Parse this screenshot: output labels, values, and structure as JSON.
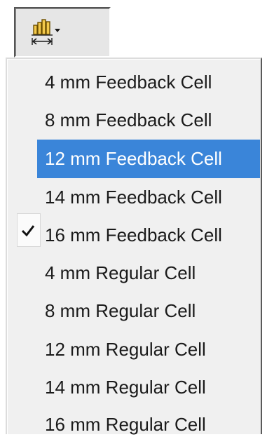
{
  "toolbar": {
    "icon": "bar-chart-width-dropdown-icon"
  },
  "menu": {
    "selected_index": 2,
    "items": [
      {
        "label": "4 mm Feedback Cell"
      },
      {
        "label": "8 mm Feedback Cell"
      },
      {
        "label": "12 mm Feedback Cell"
      },
      {
        "label": "14 mm Feedback Cell"
      },
      {
        "label": "16 mm Feedback Cell"
      },
      {
        "label": "4 mm Regular Cell"
      },
      {
        "label": "8 mm Regular Cell"
      },
      {
        "label": "12 mm Regular Cell"
      },
      {
        "label": "14 mm Regular Cell"
      },
      {
        "label": "16 mm Regular Cell"
      }
    ]
  },
  "colors": {
    "highlight": "#3a85d9",
    "menu_background": "#f0f0f0",
    "icon_accent": "#c8a020"
  }
}
